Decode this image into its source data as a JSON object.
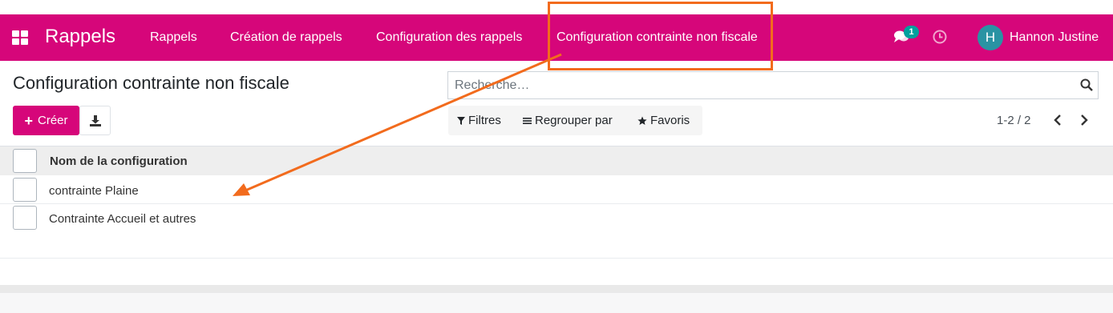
{
  "navbar": {
    "app_name": "Rappels",
    "menu": [
      {
        "label": "Rappels"
      },
      {
        "label": "Création de rappels"
      },
      {
        "label": "Configuration des rappels"
      },
      {
        "label": "Configuration contrainte non fiscale"
      }
    ],
    "messages_count": "1",
    "user": {
      "initial": "H",
      "name": "Hannon Justine"
    },
    "color": "#d6067a"
  },
  "page": {
    "title": "Configuration contrainte non fiscale",
    "create_label": "Créer"
  },
  "search": {
    "placeholder": "Recherche…"
  },
  "filters": {
    "filters_label": "Filtres",
    "group_by_label": "Regrouper par",
    "favorites_label": "Favoris"
  },
  "pager": {
    "value": "1-2 / 2"
  },
  "table": {
    "column": "Nom de la configuration",
    "rows": [
      {
        "name": "contrainte Plaine"
      },
      {
        "name": "Contrainte Accueil et autres"
      }
    ]
  },
  "icons": [
    "apps-icon",
    "chat-icon",
    "clock-icon",
    "download-icon",
    "search-icon",
    "filter-icon",
    "list-icon",
    "star-icon",
    "chevron-left-icon",
    "chevron-right-icon"
  ],
  "annotation_color": "#f26b1d"
}
